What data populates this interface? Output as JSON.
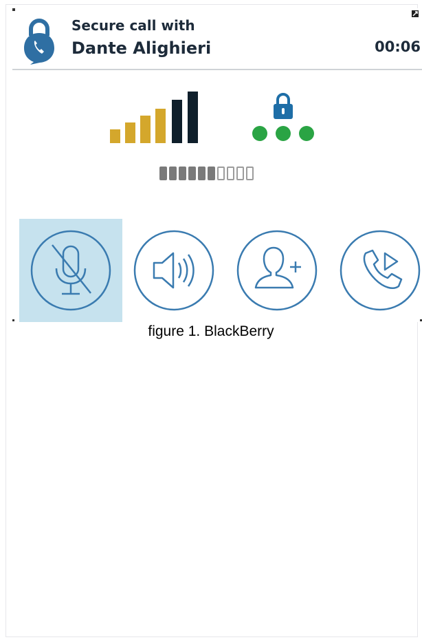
{
  "call": {
    "title_line1": "Secure call with",
    "contact_name": "Dante Alighieri",
    "duration": "00:06"
  },
  "signal": {
    "bars_total": 6,
    "bars_gold": 4,
    "bars_dark": 2,
    "gold_color": "#d4a72c",
    "dark_color": "#0f1f2b"
  },
  "security": {
    "icon": "lock-icon",
    "dots": 3,
    "dot_color": "#2aa444",
    "lock_color": "#1e6ea7"
  },
  "audio_meter": {
    "segments_total": 10,
    "segments_active": 6
  },
  "actions": [
    {
      "id": "mute",
      "icon": "microphone-muted-icon",
      "selected": true
    },
    {
      "id": "speaker",
      "icon": "speaker-icon",
      "selected": false
    },
    {
      "id": "add",
      "icon": "add-contact-icon",
      "selected": false
    },
    {
      "id": "transfer",
      "icon": "phone-transfer-icon",
      "selected": false
    }
  ],
  "colors": {
    "accent": "#3a7bb0",
    "selected_bg": "#c6e2ee",
    "text": "#1d2b3a"
  },
  "caption": "figure 1. BlackBerry"
}
